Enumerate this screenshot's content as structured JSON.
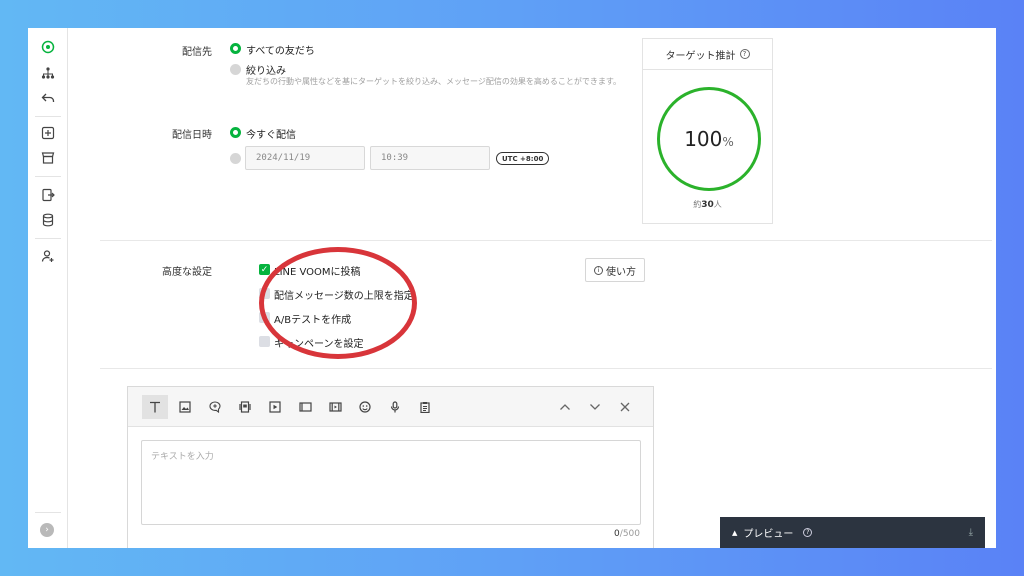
{
  "delivery": {
    "target_label": "配信先",
    "all_friends": "すべての友だち",
    "narrow": "絞り込み",
    "narrow_hint": "友だちの行動や属性などを基にターゲットを絞り込み、メッセージ配信の効果を高めることができます。",
    "datetime_label": "配信日時",
    "send_now": "今すぐ配信",
    "date_value": "2024/11/19",
    "time_value": "10:39",
    "timezone": "UTC +8:00"
  },
  "target_panel": {
    "title": "ターゲット推計",
    "percent": "100",
    "percent_unit": "%",
    "count_prefix": "約",
    "count": "30",
    "count_unit": "人",
    "ring_color": "#2bb22b"
  },
  "advanced": {
    "label": "高度な設定",
    "options": [
      {
        "label": "LINE VOOMに投稿",
        "checked": true
      },
      {
        "label": "配信メッセージ数の上限を指定",
        "checked": false
      },
      {
        "label": "A/Bテストを作成",
        "checked": false
      },
      {
        "label": "キャンペーンを設定",
        "checked": false
      }
    ],
    "help_label": "使い方"
  },
  "editor": {
    "toolbar_icons": [
      "text-icon",
      "image-icon",
      "chat-bubble-icon",
      "card-icon",
      "video-icon",
      "rich-message-icon",
      "rich-video-icon",
      "emoji-icon",
      "microphone-icon",
      "clipboard-icon"
    ],
    "placeholder": "テキストを入力",
    "char_count": "0",
    "char_limit": "/500"
  },
  "preview": {
    "label": "プレビュー"
  },
  "colors": {
    "accent_green": "#06b33e",
    "highlight_red": "#d8353a",
    "preview_bg": "#2c3440"
  }
}
